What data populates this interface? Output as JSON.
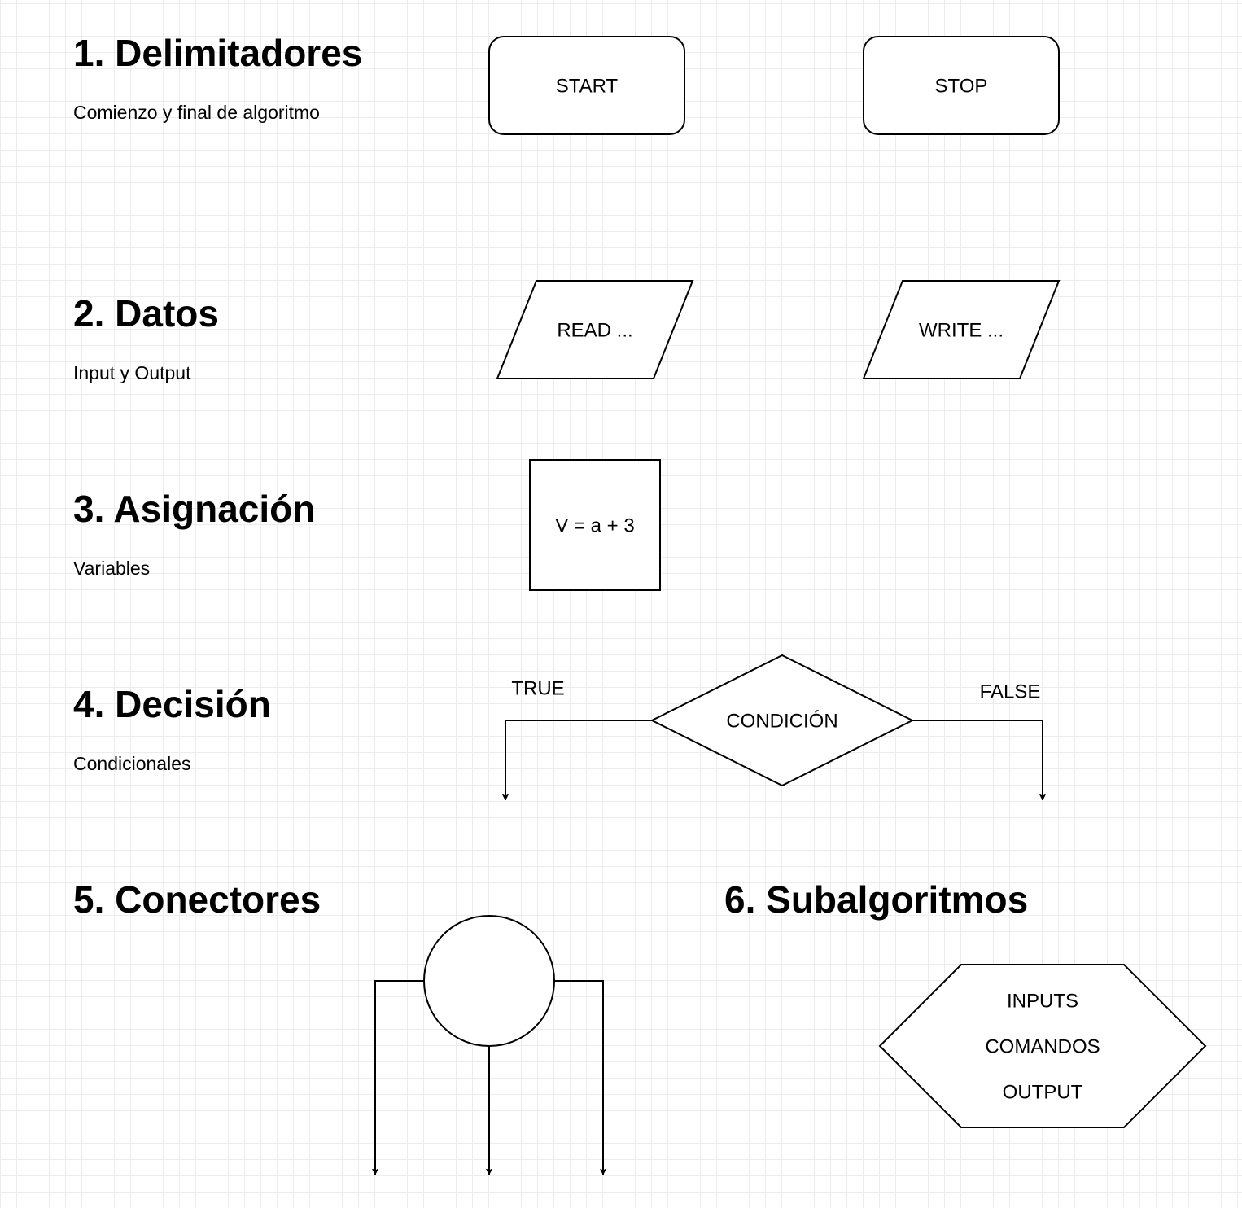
{
  "sections": [
    {
      "title": "1. Delimitadores",
      "subtitle": "Comienzo y final de algoritmo"
    },
    {
      "title": "2. Datos",
      "subtitle": "Input y Output"
    },
    {
      "title": "3. Asignación",
      "subtitle": "Variables"
    },
    {
      "title": "4. Decisión",
      "subtitle": "Condicionales"
    },
    {
      "title": "5. Conectores"
    },
    {
      "title": "6. Subalgoritmos"
    }
  ],
  "shapes": {
    "start": "START",
    "stop": "STOP",
    "read": "READ ...",
    "write": "WRITE ...",
    "assignment": "V = a + 3",
    "condition": "CONDICIÓN",
    "subalgorithm": [
      "INPUTS",
      "COMANDOS",
      "OUTPUT"
    ]
  },
  "edge_labels": {
    "true": "TRUE",
    "false": "FALSE"
  },
  "colors": {
    "stroke": "#000000",
    "fill": "#ffffff",
    "grid": "#ececec"
  }
}
